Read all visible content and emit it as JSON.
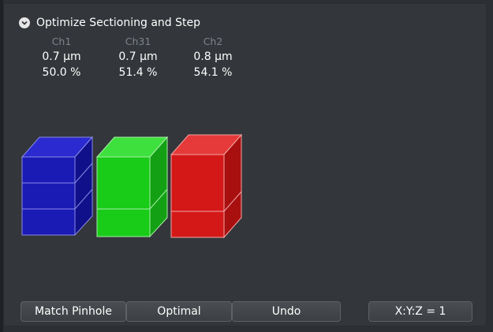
{
  "panel": {
    "title": "Optimize Sectioning and Step",
    "channels": [
      {
        "name": "Ch1",
        "thickness": "0.7 µm",
        "percent": "50.0 %",
        "color": "#1515b8"
      },
      {
        "name": "Ch31",
        "thickness": "0.7 µm",
        "percent": "51.4 %",
        "color": "#15c515"
      },
      {
        "name": "Ch2",
        "thickness": "0.8 µm",
        "percent": "54.1 %",
        "color": "#d41515"
      }
    ]
  },
  "buttons": {
    "match_pinhole": "Match Pinhole",
    "optimal": "Optimal",
    "undo": "Undo",
    "xyz": "X:Y:Z = 1"
  },
  "icons": {
    "collapse": "chevron-down-circle-icon"
  }
}
